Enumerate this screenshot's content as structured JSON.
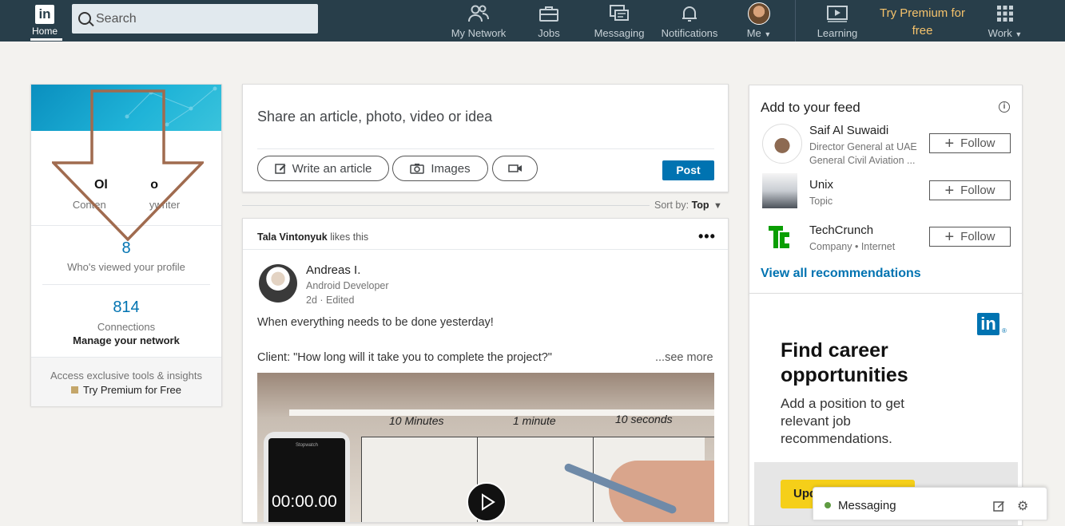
{
  "nav": {
    "logo": "in",
    "home": "Home",
    "search_placeholder": "Search",
    "my_network": "My Network",
    "jobs": "Jobs",
    "messaging": "Messaging",
    "notifications": "Notifications",
    "me": "Me",
    "learning": "Learning",
    "premium_line1": "Try Premium for",
    "premium_line2": "free",
    "work": "Work"
  },
  "profile": {
    "name": "Ol            o",
    "headline": "Conten               ywriter",
    "views_count": "8",
    "views_label": "Who's viewed your profile",
    "connections_count": "814",
    "connections_label": "Connections",
    "manage_network": "Manage your network",
    "premium_text": "Access exclusive tools & insights",
    "premium_link": "Try Premium for Free"
  },
  "share": {
    "prompt": "Share an article, photo, video or idea",
    "write_article": "Write an article",
    "images": "Images",
    "post": "Post"
  },
  "sort": {
    "label": "Sort by:",
    "value": "Top"
  },
  "feed": {
    "actor": "Tala Vintonyuk",
    "action": " likes this",
    "author_name": "Andreas I.",
    "author_title": "Android Developer",
    "author_time": "2d · Edited",
    "text_line1": "When everything needs to be done yesterday!",
    "text_line2": "Client: \"How long will it take you to complete the project?\"",
    "see_more": "...see more",
    "video_labels": [
      "10 Minutes",
      "1 minute",
      "10 seconds"
    ],
    "video_timer": "00:00.00",
    "video_phone_label": "Stopwatch"
  },
  "rightbar": {
    "title": "Add to your feed",
    "recommendations": [
      {
        "name": "Saif Al Suwaidi",
        "sub1": "Director General at UAE",
        "sub2": "General Civil Aviation ...",
        "follow": "Follow"
      },
      {
        "name": "Unix",
        "sub1": "Topic",
        "sub2": "",
        "follow": "Follow"
      },
      {
        "name": "TechCrunch",
        "sub1": "Company • Internet",
        "sub2": "",
        "follow": "Follow"
      }
    ],
    "view_all": "View all recommendations"
  },
  "ad": {
    "logo": "in",
    "headline_line1": "Find career",
    "headline_line2": "opportunities",
    "body_line1": "Add a position to get",
    "body_line2": "relevant job",
    "body_line3": "recommendations.",
    "cta": "Upd"
  },
  "messaging": {
    "label": "Messaging"
  },
  "colors": {
    "nav_bg": "#283e4a",
    "brand_blue": "#0073b1",
    "premium_gold": "#f5c26b",
    "page_bg": "#f3f2ef",
    "online_green": "#5f9b41"
  }
}
